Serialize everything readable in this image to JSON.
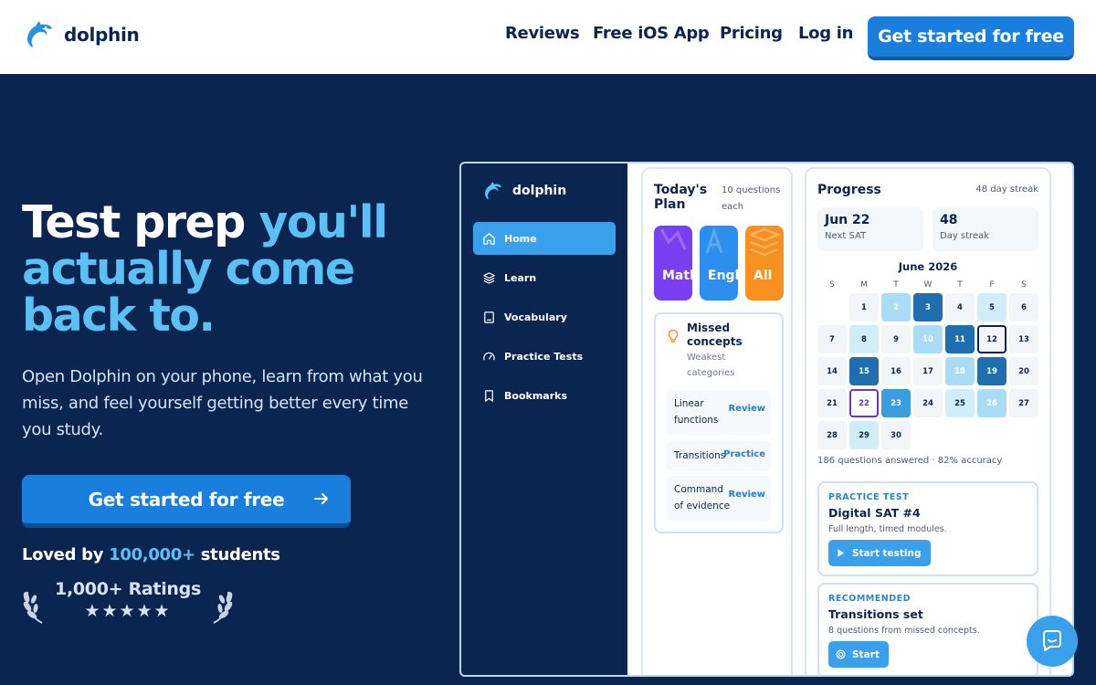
{
  "nav": {
    "brand": "dolphin",
    "links": [
      "Reviews",
      "Free iOS App",
      "Pricing",
      "Log in"
    ],
    "cta": "Get started for free"
  },
  "hero": {
    "title_white": "Test prep ",
    "title_accent": "you'll actually come back to.",
    "subtitle": "Open Dolphin on your phone, learn from what you miss, and feel yourself getting better every time you study.",
    "cta": "Get started for free",
    "loved_prefix": "Loved by ",
    "loved_count": "100,000+",
    "loved_suffix": " students",
    "ratings_label": "1,000+ Ratings",
    "stars": "★★★★★"
  },
  "app": {
    "brand": "dolphin",
    "sidebar": [
      {
        "label": "Home",
        "icon": "home-icon"
      },
      {
        "label": "Learn",
        "icon": "layers-icon"
      },
      {
        "label": "Vocabulary",
        "icon": "book-icon"
      },
      {
        "label": "Practice Tests",
        "icon": "gauge-icon"
      },
      {
        "label": "Bookmarks",
        "icon": "bookmark-icon"
      }
    ],
    "plan": {
      "title": "Today's Plan",
      "note": "10 questions each",
      "subjects": [
        "Math",
        "English",
        "All"
      ],
      "missed_title": "Missed concepts",
      "missed_sub": "Weakest categories",
      "missed": [
        {
          "label": "Linear functions",
          "action": "Review"
        },
        {
          "label": "Transitions",
          "action": "Practice"
        },
        {
          "label": "Command of evidence",
          "action": "Review"
        }
      ]
    },
    "progress": {
      "title": "Progress",
      "streak": "48 day streak",
      "stat1_big": "Jun 22",
      "stat1_small": "Next SAT",
      "stat2_big": "48",
      "stat2_small": "Day streak",
      "month": "June 2026",
      "weekdays": [
        "S",
        "M",
        "T",
        "W",
        "T",
        "F",
        "S"
      ],
      "start_offset": 1,
      "days": [
        {
          "d": "1",
          "l": 0
        },
        {
          "d": "2",
          "l": 1
        },
        {
          "d": "3",
          "l": 3
        },
        {
          "d": "4",
          "l": 0
        },
        {
          "d": "5",
          "l": 5
        },
        {
          "d": "6",
          "l": 0
        },
        {
          "d": "7",
          "l": 0
        },
        {
          "d": "8",
          "l": 5
        },
        {
          "d": "9",
          "l": 0
        },
        {
          "d": "10",
          "l": 1
        },
        {
          "d": "11",
          "l": 3
        },
        {
          "d": "12",
          "l": 4
        },
        {
          "d": "13",
          "l": 0
        },
        {
          "d": "14",
          "l": 0
        },
        {
          "d": "15",
          "l": 3
        },
        {
          "d": "16",
          "l": 0
        },
        {
          "d": "17",
          "l": 0
        },
        {
          "d": "18",
          "l": 1
        },
        {
          "d": "19",
          "l": 3
        },
        {
          "d": "20",
          "l": 0
        },
        {
          "d": "21",
          "l": 0
        },
        {
          "d": "22",
          "l": 9
        },
        {
          "d": "23",
          "l": 2
        },
        {
          "d": "24",
          "l": 0
        },
        {
          "d": "25",
          "l": 5
        },
        {
          "d": "26",
          "l": 1
        },
        {
          "d": "27",
          "l": 0
        },
        {
          "d": "28",
          "l": 0
        },
        {
          "d": "29",
          "l": 5
        },
        {
          "d": "30",
          "l": 0
        }
      ],
      "answered": "186 questions answered · 82% accuracy",
      "card1": {
        "kicker": "PRACTICE TEST",
        "name": "Digital SAT #4",
        "desc": "Full length, timed modules.",
        "btn": "Start testing"
      },
      "card2": {
        "kicker": "RECOMMENDED",
        "name": "Transitions set",
        "desc": "8 questions from missed concepts.",
        "btn": "Start"
      }
    }
  },
  "colors": {
    "navy": "#0b2551",
    "accent": "#5bc0f5",
    "primary": "#1a7fdc",
    "math": "#7a3ff0",
    "english": "#2c8ff0",
    "all": "#f7901e"
  }
}
